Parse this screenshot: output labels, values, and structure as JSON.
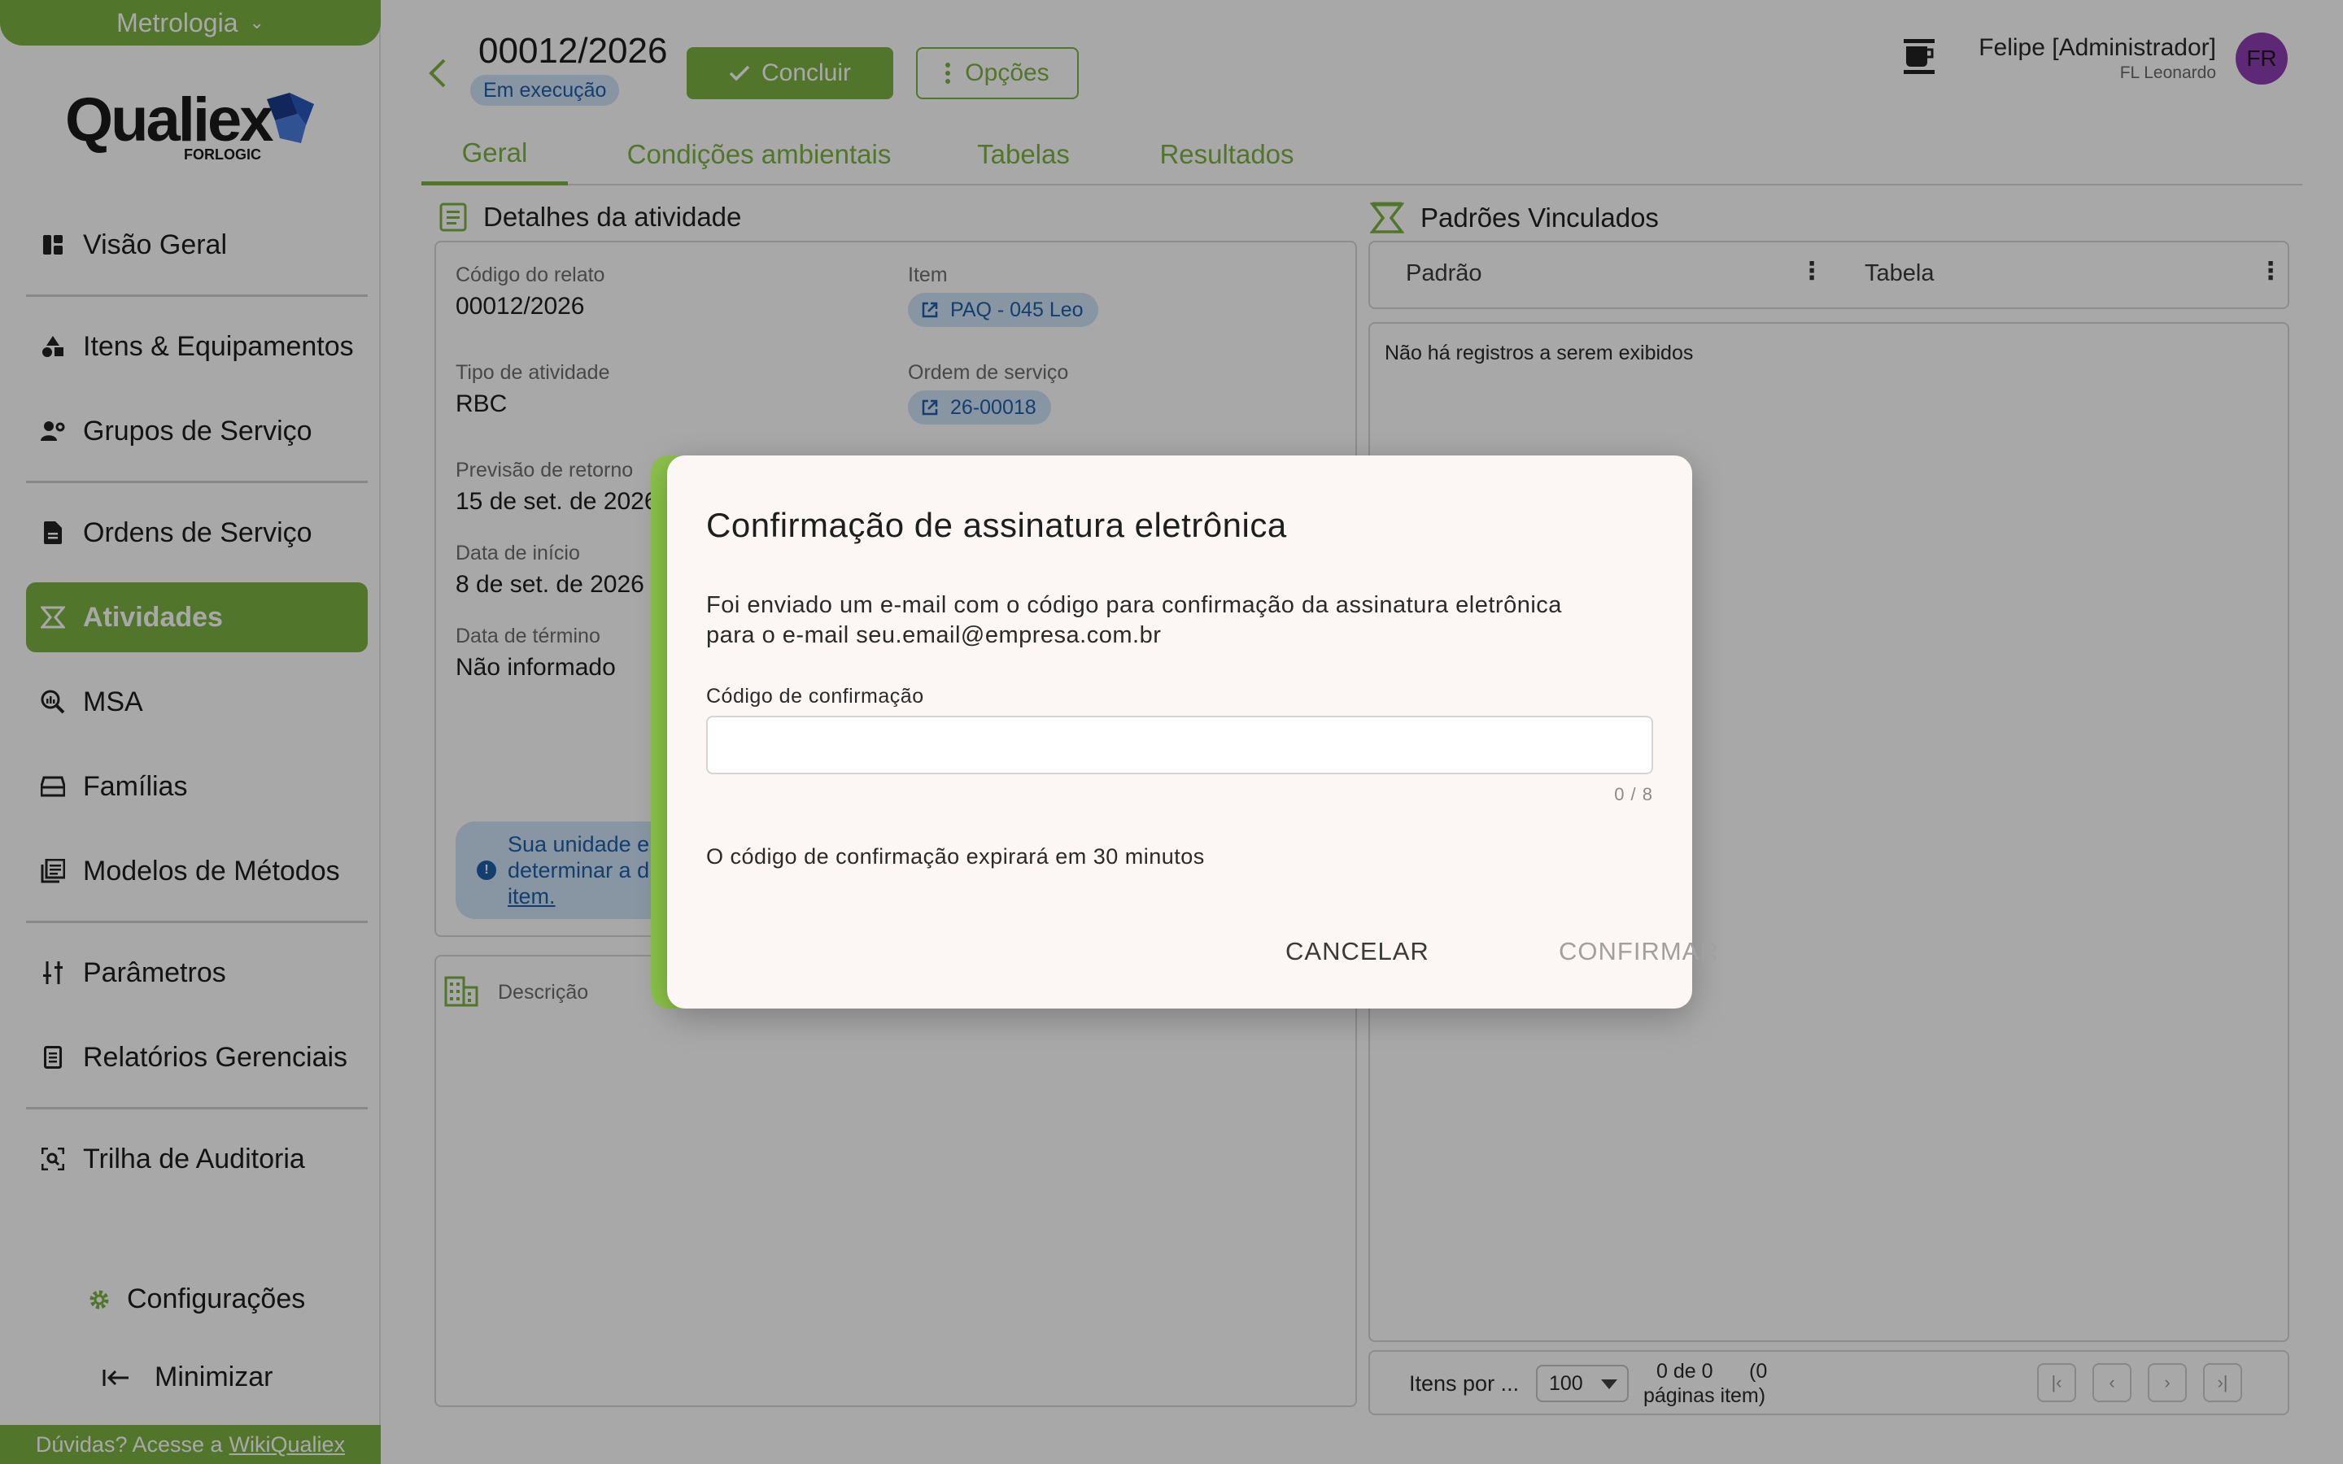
{
  "sidebar": {
    "module": "Metrologia",
    "logo": {
      "name": "Qualiex",
      "sub": "FORLOGIC"
    },
    "items": [
      {
        "label": "Visão Geral",
        "icon": "dashboard-icon"
      },
      {
        "label": "Itens & Equipamentos",
        "icon": "shapes-icon"
      },
      {
        "label": "Grupos de Serviço",
        "icon": "people-gear-icon"
      },
      {
        "label": "Ordens de Serviço",
        "icon": "document-icon"
      },
      {
        "label": "Atividades",
        "icon": "scale-icon",
        "active": true
      },
      {
        "label": "MSA",
        "icon": "magnifier-chart-icon"
      },
      {
        "label": "Famílias",
        "icon": "drawer-icon"
      },
      {
        "label": "Modelos de Métodos",
        "icon": "library-icon"
      },
      {
        "label": "Parâmetros",
        "icon": "sliders-icon"
      },
      {
        "label": "Relatórios Gerenciais",
        "icon": "report-icon"
      },
      {
        "label": "Trilha de Auditoria",
        "icon": "audit-trail-icon"
      }
    ],
    "settings_label": "Configurações",
    "minimize_label": "Minimizar",
    "help_text": "Dúvidas? Acesse a",
    "help_link": "WikiQualiex"
  },
  "header": {
    "number": "00012/2026",
    "status": "Em execução",
    "conclude_label": "Concluir",
    "options_label": "Opções",
    "user_name": "Felipe [Administrador]",
    "user_org": "FL Leonardo",
    "avatar_initials": "FR"
  },
  "tabs": [
    "Geral",
    "Condições ambientais",
    "Tabelas",
    "Resultados"
  ],
  "details": {
    "title": "Detalhes da atividade",
    "fields": {
      "report_code_label": "Código do relato",
      "report_code": "00012/2026",
      "item_label": "Item",
      "item": "PAQ - 045 Leo",
      "activity_type_label": "Tipo de atividade",
      "activity_type": "RBC",
      "service_order_label": "Ordem de serviço",
      "service_order": "26-00018",
      "return_forecast_label": "Previsão de retorno",
      "return_forecast": "15 de set. de 2026",
      "start_date_label": "Data de início",
      "start_date": "8 de set. de 2026",
      "end_date_label": "Data de término",
      "end_date": "Não informado"
    },
    "info_text_1": "Sua unidade e",
    "info_text_2": "determinar a d",
    "info_link": "item.",
    "description_label": "Descrição"
  },
  "standards": {
    "title": "Padrões Vinculados",
    "col_standard": "Padrão",
    "col_table": "Tabela",
    "empty": "Não há registros a serem exibidos",
    "pager": {
      "per_page_label": "Itens por ...",
      "per_page_value": "100",
      "count_1": "0 de 0",
      "count_2": "(0",
      "count_3": "páginas item)"
    }
  },
  "dialog": {
    "title": "Confirmação de assinatura eletrônica",
    "body_line1": "Foi enviado um e-mail com o código para confirmação da assinatura eletrônica",
    "body_line2": "para o e-mail seu.email@empresa.com.br",
    "field_label": "Código de confirmação",
    "field_value": "",
    "counter": "0 / 8",
    "note": "O código de confirmação expirará em 30 minutos",
    "cancel_label": "CANCELAR",
    "confirm_label": "CONFIRMAR"
  },
  "colors": {
    "brand_green": "#7cb342",
    "dialog_accent": "#8bc34a",
    "chip_blue_bg": "#cfe3f7",
    "chip_blue_text": "#1f5fa8",
    "avatar_purple": "#8e3fb4"
  }
}
